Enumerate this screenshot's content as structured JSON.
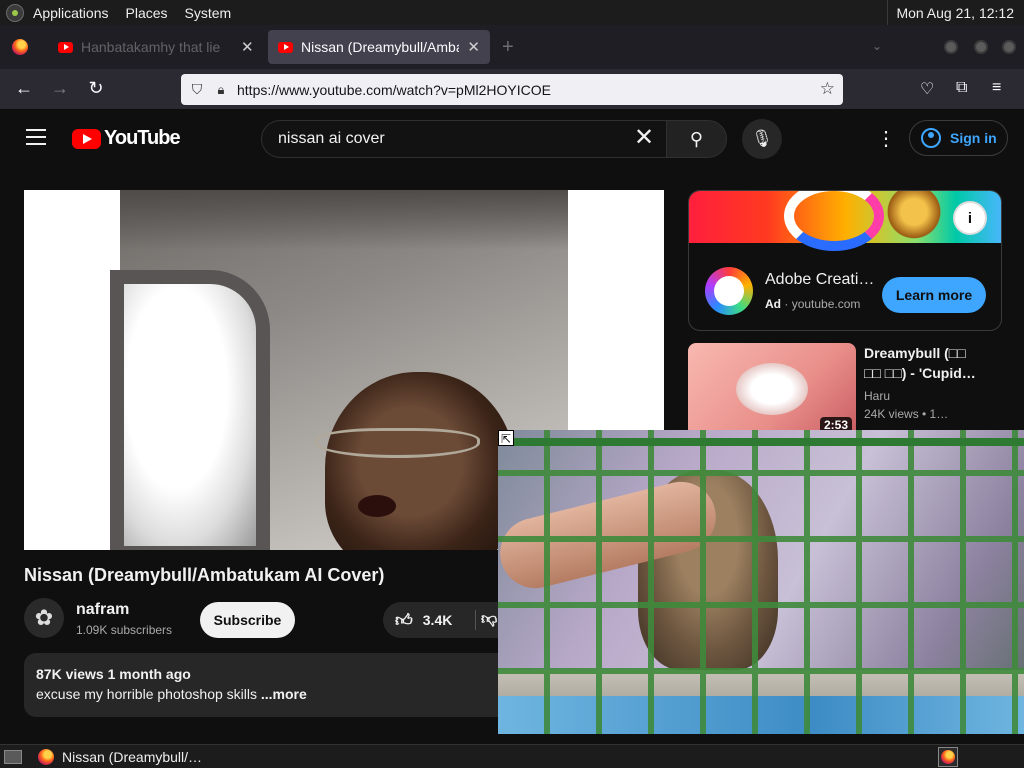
{
  "top_panel": {
    "menus": [
      "Applications",
      "Places",
      "System"
    ],
    "clock": "Mon Aug 21, 12:12"
  },
  "browser": {
    "tabs": [
      {
        "title": "Hanbatakamhy that lie",
        "active": false
      },
      {
        "title": "Nissan (Dreamybull/Ambatu",
        "active": true
      }
    ],
    "new_tab": "+",
    "url": "https://www.youtube.com/watch?v=pMl2HOYICOE"
  },
  "youtube_header": {
    "logo_text": "YouTube",
    "search_value": "nissan ai cover",
    "sign_in_label": "Sign in"
  },
  "video": {
    "title": "Nissan (Dreamybull/Ambatukam AI Cover)",
    "channel_name": "nafram",
    "subscribers": "1.09K subscribers",
    "subscribe_label": "Subscribe",
    "likes": "3.4K",
    "views_and_date": "87K views  1 month ago",
    "description": "excuse my horrible photoshop skills",
    "more_label": "...more"
  },
  "sidebar": {
    "ad": {
      "title": "Adobe Creati…",
      "tag": "Ad",
      "domain": "youtube.com",
      "learn_more_label": "Learn more"
    },
    "recommended": [
      {
        "title": "Dreamybull (□□ □□ □□) - 'Cupid…",
        "channel": "Haru",
        "meta": "24K views  • 1…",
        "duration": "2:53"
      }
    ]
  },
  "taskbar": {
    "task_title": "Nissan (Dreamybull/…"
  },
  "colors": {
    "youtube_red": "#ff0000",
    "accent_blue": "#3ea6ff",
    "page_bg": "#0f0f0f"
  }
}
